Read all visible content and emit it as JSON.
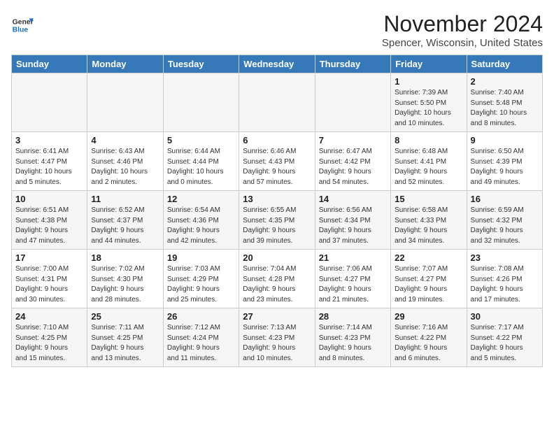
{
  "header": {
    "logo_general": "General",
    "logo_blue": "Blue",
    "month": "November 2024",
    "location": "Spencer, Wisconsin, United States"
  },
  "weekdays": [
    "Sunday",
    "Monday",
    "Tuesday",
    "Wednesday",
    "Thursday",
    "Friday",
    "Saturday"
  ],
  "weeks": [
    {
      "days": [
        {
          "num": "",
          "info": ""
        },
        {
          "num": "",
          "info": ""
        },
        {
          "num": "",
          "info": ""
        },
        {
          "num": "",
          "info": ""
        },
        {
          "num": "",
          "info": ""
        },
        {
          "num": "1",
          "info": "Sunrise: 7:39 AM\nSunset: 5:50 PM\nDaylight: 10 hours\nand 10 minutes."
        },
        {
          "num": "2",
          "info": "Sunrise: 7:40 AM\nSunset: 5:48 PM\nDaylight: 10 hours\nand 8 minutes."
        }
      ]
    },
    {
      "days": [
        {
          "num": "3",
          "info": "Sunrise: 6:41 AM\nSunset: 4:47 PM\nDaylight: 10 hours\nand 5 minutes."
        },
        {
          "num": "4",
          "info": "Sunrise: 6:43 AM\nSunset: 4:46 PM\nDaylight: 10 hours\nand 2 minutes."
        },
        {
          "num": "5",
          "info": "Sunrise: 6:44 AM\nSunset: 4:44 PM\nDaylight: 10 hours\nand 0 minutes."
        },
        {
          "num": "6",
          "info": "Sunrise: 6:46 AM\nSunset: 4:43 PM\nDaylight: 9 hours\nand 57 minutes."
        },
        {
          "num": "7",
          "info": "Sunrise: 6:47 AM\nSunset: 4:42 PM\nDaylight: 9 hours\nand 54 minutes."
        },
        {
          "num": "8",
          "info": "Sunrise: 6:48 AM\nSunset: 4:41 PM\nDaylight: 9 hours\nand 52 minutes."
        },
        {
          "num": "9",
          "info": "Sunrise: 6:50 AM\nSunset: 4:39 PM\nDaylight: 9 hours\nand 49 minutes."
        }
      ]
    },
    {
      "days": [
        {
          "num": "10",
          "info": "Sunrise: 6:51 AM\nSunset: 4:38 PM\nDaylight: 9 hours\nand 47 minutes."
        },
        {
          "num": "11",
          "info": "Sunrise: 6:52 AM\nSunset: 4:37 PM\nDaylight: 9 hours\nand 44 minutes."
        },
        {
          "num": "12",
          "info": "Sunrise: 6:54 AM\nSunset: 4:36 PM\nDaylight: 9 hours\nand 42 minutes."
        },
        {
          "num": "13",
          "info": "Sunrise: 6:55 AM\nSunset: 4:35 PM\nDaylight: 9 hours\nand 39 minutes."
        },
        {
          "num": "14",
          "info": "Sunrise: 6:56 AM\nSunset: 4:34 PM\nDaylight: 9 hours\nand 37 minutes."
        },
        {
          "num": "15",
          "info": "Sunrise: 6:58 AM\nSunset: 4:33 PM\nDaylight: 9 hours\nand 34 minutes."
        },
        {
          "num": "16",
          "info": "Sunrise: 6:59 AM\nSunset: 4:32 PM\nDaylight: 9 hours\nand 32 minutes."
        }
      ]
    },
    {
      "days": [
        {
          "num": "17",
          "info": "Sunrise: 7:00 AM\nSunset: 4:31 PM\nDaylight: 9 hours\nand 30 minutes."
        },
        {
          "num": "18",
          "info": "Sunrise: 7:02 AM\nSunset: 4:30 PM\nDaylight: 9 hours\nand 28 minutes."
        },
        {
          "num": "19",
          "info": "Sunrise: 7:03 AM\nSunset: 4:29 PM\nDaylight: 9 hours\nand 25 minutes."
        },
        {
          "num": "20",
          "info": "Sunrise: 7:04 AM\nSunset: 4:28 PM\nDaylight: 9 hours\nand 23 minutes."
        },
        {
          "num": "21",
          "info": "Sunrise: 7:06 AM\nSunset: 4:27 PM\nDaylight: 9 hours\nand 21 minutes."
        },
        {
          "num": "22",
          "info": "Sunrise: 7:07 AM\nSunset: 4:27 PM\nDaylight: 9 hours\nand 19 minutes."
        },
        {
          "num": "23",
          "info": "Sunrise: 7:08 AM\nSunset: 4:26 PM\nDaylight: 9 hours\nand 17 minutes."
        }
      ]
    },
    {
      "days": [
        {
          "num": "24",
          "info": "Sunrise: 7:10 AM\nSunset: 4:25 PM\nDaylight: 9 hours\nand 15 minutes."
        },
        {
          "num": "25",
          "info": "Sunrise: 7:11 AM\nSunset: 4:25 PM\nDaylight: 9 hours\nand 13 minutes."
        },
        {
          "num": "26",
          "info": "Sunrise: 7:12 AM\nSunset: 4:24 PM\nDaylight: 9 hours\nand 11 minutes."
        },
        {
          "num": "27",
          "info": "Sunrise: 7:13 AM\nSunset: 4:23 PM\nDaylight: 9 hours\nand 10 minutes."
        },
        {
          "num": "28",
          "info": "Sunrise: 7:14 AM\nSunset: 4:23 PM\nDaylight: 9 hours\nand 8 minutes."
        },
        {
          "num": "29",
          "info": "Sunrise: 7:16 AM\nSunset: 4:22 PM\nDaylight: 9 hours\nand 6 minutes."
        },
        {
          "num": "30",
          "info": "Sunrise: 7:17 AM\nSunset: 4:22 PM\nDaylight: 9 hours\nand 5 minutes."
        }
      ]
    }
  ]
}
